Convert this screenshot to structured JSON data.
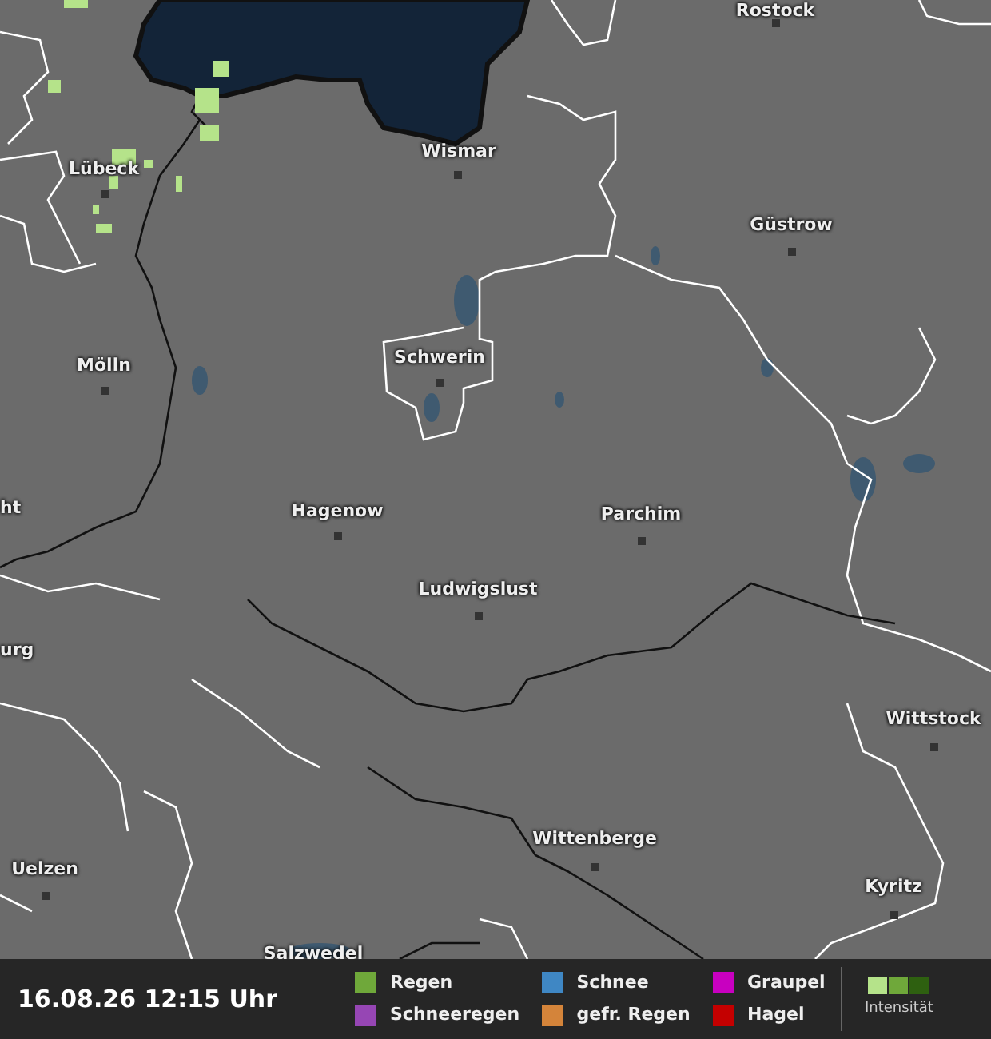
{
  "map": {
    "cities": [
      {
        "label": "Rostock"
      },
      {
        "label": "Wismar"
      },
      {
        "label": "Lübeck"
      },
      {
        "label": "Güstrow"
      },
      {
        "label": "Mölln"
      },
      {
        "label": "Schwerin"
      },
      {
        "label": "ht"
      },
      {
        "label": "Hagenow"
      },
      {
        "label": "Parchim"
      },
      {
        "label": "Ludwigslust"
      },
      {
        "label": "urg"
      },
      {
        "label": "Wittstock"
      },
      {
        "label": "Wittenberge"
      },
      {
        "label": "Uelzen"
      },
      {
        "label": "Kyritz"
      },
      {
        "label": "Salzwedel"
      }
    ]
  },
  "footer": {
    "timestamp": "16.08.26 12:15 Uhr",
    "legend": [
      {
        "label": "Regen",
        "color": "#6fa83a"
      },
      {
        "label": "Schneeregen",
        "color": "#9646b4"
      },
      {
        "label": "Schnee",
        "color": "#3f87c4"
      },
      {
        "label": "gefr. Regen",
        "color": "#d4843a"
      },
      {
        "label": "Graupel",
        "color": "#c800c0"
      },
      {
        "label": "Hagel",
        "color": "#c40000"
      }
    ],
    "intensity_label": "Intensität"
  }
}
